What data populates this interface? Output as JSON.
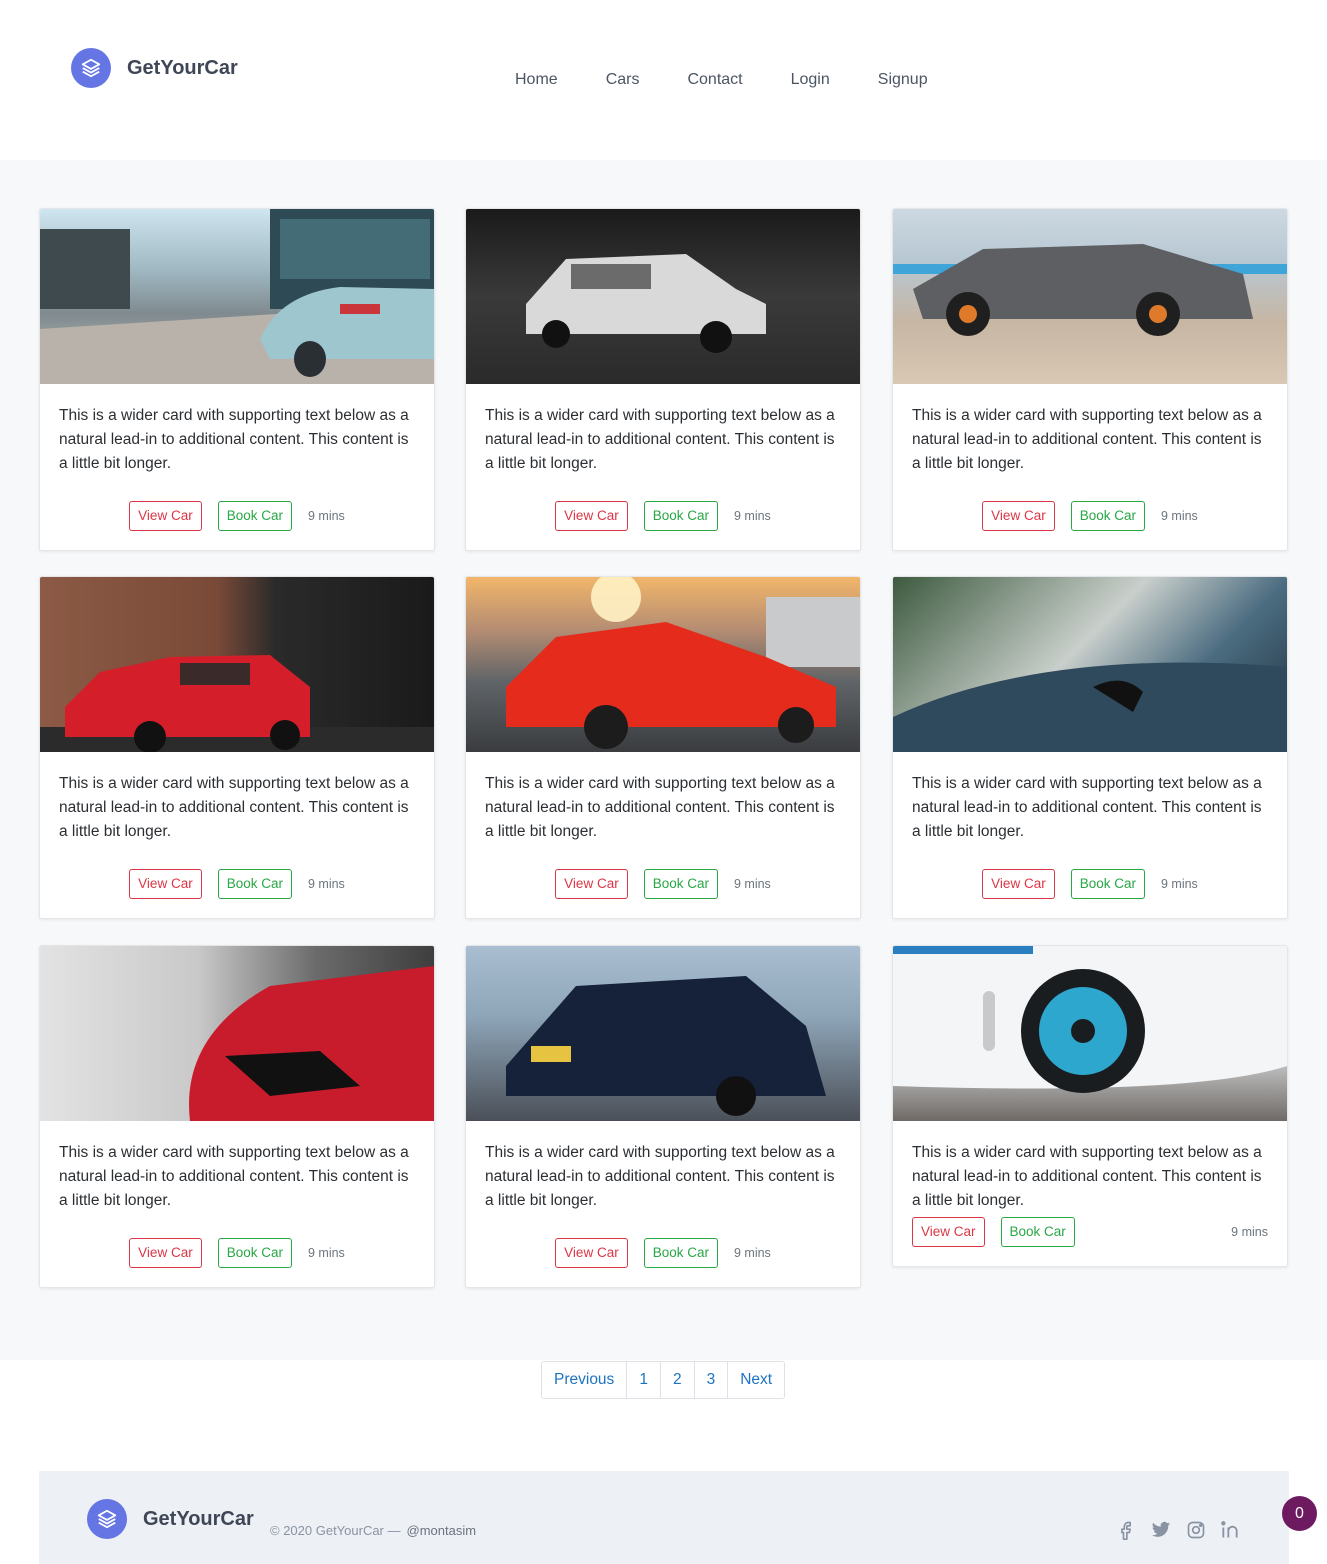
{
  "header": {
    "brand": "GetYourCar",
    "nav": [
      "Home",
      "Cars",
      "Contact",
      "Login",
      "Signup"
    ]
  },
  "cards": [
    {
      "text": "This is a wider card with supporting text below as a natural lead-in to additional content. This content is a little bit longer.",
      "view_label": "View Car",
      "book_label": "Book Car",
      "time": "9 mins",
      "image": "silver-sedan-street-photo"
    },
    {
      "text": "This is a wider card with supporting text below as a natural lead-in to additional content. This content is a little bit longer.",
      "view_label": "View Car",
      "book_label": "Book Car",
      "time": "9 mins",
      "image": "vintage-white-car-photo"
    },
    {
      "text": "This is a wider card with supporting text below as a natural lead-in to additional content. This content is a little bit longer.",
      "view_label": "View Car",
      "book_label": "Book Car",
      "time": "9 mins",
      "image": "grey-mustang-photo"
    },
    {
      "text": "This is a wider card with supporting text below as a natural lead-in to additional content. This content is a little bit longer.",
      "view_label": "View Car",
      "book_label": "Book Car",
      "time": "9 mins",
      "image": "red-hatchback-photo"
    },
    {
      "text": "This is a wider card with supporting text below as a natural lead-in to additional content. This content is a little bit longer.",
      "view_label": "View Car",
      "book_label": "Book Car",
      "time": "9 mins",
      "image": "red-sportscar-sunset-photo"
    },
    {
      "text": "This is a wider card with supporting text below as a natural lead-in to additional content. This content is a little bit longer.",
      "view_label": "View Car",
      "book_label": "Book Car",
      "time": "9 mins",
      "image": "blue-jaguar-hood-photo"
    },
    {
      "text": "This is a wider card with supporting text below as a natural lead-in to additional content. This content is a little bit longer.",
      "view_label": "View Car",
      "book_label": "Book Car",
      "time": "9 mins",
      "image": "red-car-headlight-photo"
    },
    {
      "text": "This is a wider card with supporting text below as a natural lead-in to additional content. This content is a little bit longer.",
      "view_label": "View Car",
      "book_label": "Book Car",
      "time": "9 mins",
      "image": "dark-blue-hatchback-photo"
    },
    {
      "text": "This is a wider card with supporting text below as a natural lead-in to additional content. This content is a little bit longer.",
      "view_label": "View Car",
      "book_label": "Book Car",
      "time": "9 mins",
      "image": "white-car-blue-wheel-photo"
    }
  ],
  "pagination": {
    "previous": "Previous",
    "pages": [
      "1",
      "2",
      "3"
    ],
    "next": "Next"
  },
  "footer": {
    "brand": "GetYourCar",
    "copyright": "© 2020 GetYourCar —",
    "handle": "@montasim",
    "socials": [
      "facebook-icon",
      "twitter-icon",
      "instagram-icon",
      "linkedin-icon"
    ]
  },
  "badge": "0",
  "colors": {
    "accent": "#6675e4",
    "view": "#dc3545",
    "book": "#28a745",
    "link": "#1e73be",
    "badge": "#6e1a61"
  }
}
